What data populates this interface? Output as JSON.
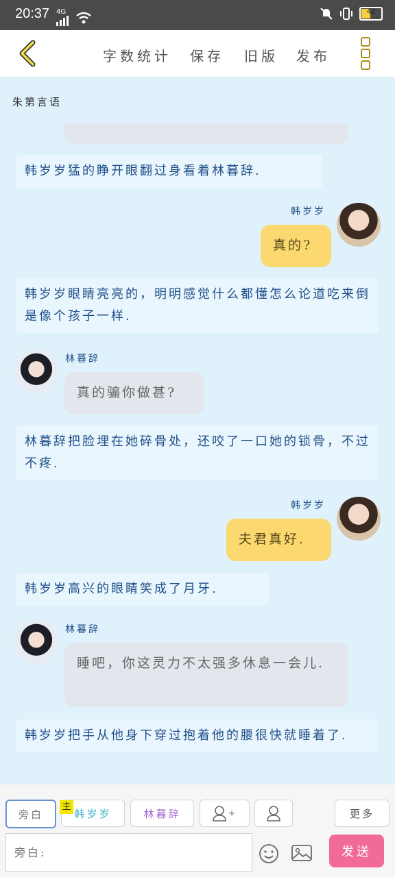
{
  "status": {
    "time": "20:37",
    "network": "4G",
    "battery": "42"
  },
  "nav": {
    "wordcount": "字数统计",
    "save": "保存",
    "oldversion": "旧版",
    "publish": "发布"
  },
  "book_title": "朱第言语",
  "messages": [
    {
      "kind": "narration",
      "text": "韩岁岁猛的睁开眼翻过身看着林暮辞."
    },
    {
      "kind": "right",
      "name": "韩岁岁",
      "text": "真的?"
    },
    {
      "kind": "narration",
      "text": "韩岁岁眼睛亮亮的，明明感觉什么都懂怎么论道吃来倒是像个孩子一样."
    },
    {
      "kind": "left",
      "name": "林暮辞",
      "text": "真的骗你做甚?"
    },
    {
      "kind": "narration",
      "text": "林暮辞把脸埋在她碎骨处，还咬了一口她的锁骨，不过不疼."
    },
    {
      "kind": "right",
      "name": "韩岁岁",
      "text": "夫君真好."
    },
    {
      "kind": "narration",
      "text": "韩岁岁高兴的眼睛笑成了月牙."
    },
    {
      "kind": "left",
      "name": "林暮辞",
      "text": "睡吧，你这灵力不太强多休息一会儿."
    },
    {
      "kind": "narration",
      "text": "韩岁岁把手从他身下穿过抱着他的腰很快就睡着了."
    }
  ],
  "toolbar": {
    "narrator": "旁白",
    "main_tag": "主",
    "char1": "韩岁岁",
    "char2": "林暮辞",
    "add_char_plus": "+",
    "more": "更多",
    "input_placeholder": "旁白:",
    "send": "发送"
  },
  "colors": {
    "accent_send": "#f26b97",
    "char1": "#3bb2c7",
    "char2": "#a56bd6",
    "narration_text": "#1f4f8a"
  }
}
